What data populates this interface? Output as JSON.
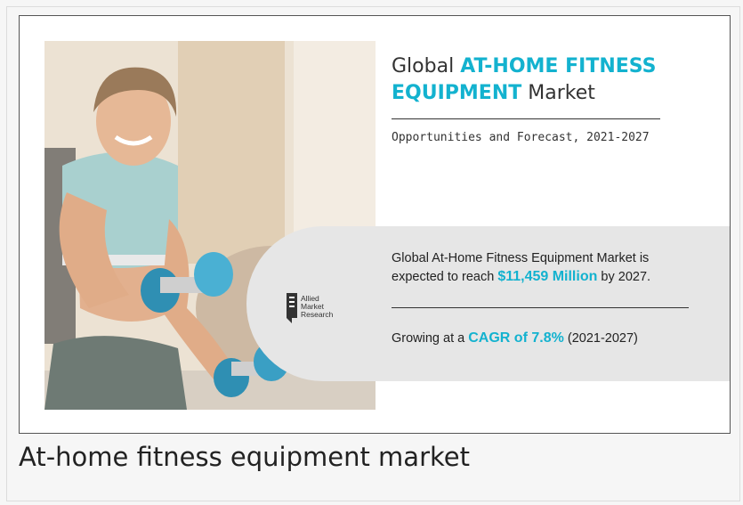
{
  "figure": {
    "title_prefix": "Global",
    "title_accent_1": "AT-HOME FITNESS",
    "title_accent_2": "EQUIPMENT",
    "title_suffix": "Market",
    "subtitle": "Opportunities and Forecast, 2021-2027",
    "stat1_text_a": "Global At-Home Fitness Equipment Market is",
    "stat1_text_b": "expected to reach",
    "stat1_value": "$11,459 Million",
    "stat1_text_c": "by 2027.",
    "stat2_text_a": "Growing at a",
    "stat2_value": "CAGR of 7.8%",
    "stat2_text_b": "(2021-2027)",
    "logo_line1": "Allied",
    "logo_line2": "Market",
    "logo_line3": "Research"
  },
  "caption": "At-home fitness equipment market",
  "colors": {
    "accent": "#13b2cf",
    "band": "#e6e6e6",
    "text": "#333333"
  }
}
